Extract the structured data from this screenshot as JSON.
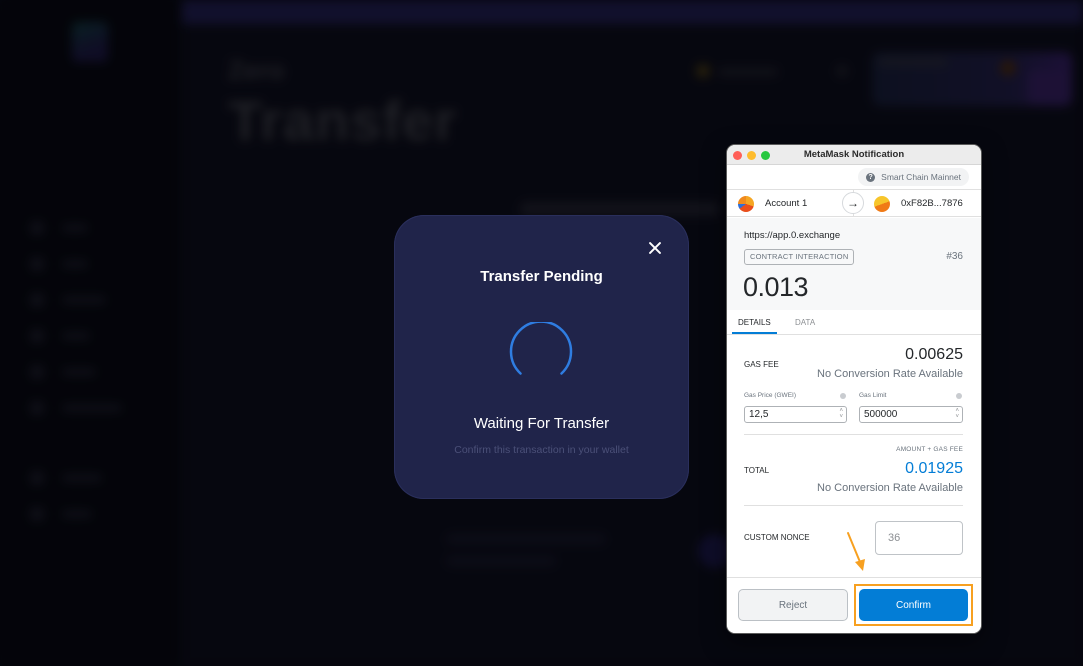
{
  "background_app": {
    "brand": "Zero",
    "title": "Transfer",
    "sidebar": {
      "item_count": 8
    }
  },
  "modal": {
    "title": "Transfer Pending",
    "status": "Waiting For Transfer",
    "hint": "Confirm this transaction in your wallet",
    "close_icon": "close-icon",
    "spinner_color": "#2f7de1"
  },
  "metamask": {
    "window_title": "MetaMask Notification",
    "network": "Smart Chain Mainnet",
    "from_account": "Account 1",
    "to_address": "0xF82B...7876",
    "origin": "https://app.0.exchange",
    "badge": "CONTRACT INTERACTION",
    "nonce_tag": "#36",
    "amount": "0.013",
    "tabs": [
      {
        "label": "DETAILS",
        "active": true
      },
      {
        "label": "DATA",
        "active": false
      }
    ],
    "gas_fee": {
      "label": "GAS FEE",
      "value": "0.00625",
      "conversion": "No Conversion Rate Available"
    },
    "gas_price": {
      "label": "Gas Price (GWEI)",
      "value": "12,5"
    },
    "gas_limit": {
      "label": "Gas Limit",
      "value": "500000"
    },
    "total": {
      "caption": "AMOUNT + GAS FEE",
      "label": "TOTAL",
      "value": "0.01925",
      "conversion": "No Conversion Rate Available"
    },
    "custom_nonce": {
      "label": "CUSTOM NONCE",
      "placeholder": "36"
    },
    "buttons": {
      "reject": "Reject",
      "confirm": "Confirm"
    },
    "colors": {
      "primary": "#037dd6",
      "highlight": "#f7a020"
    }
  }
}
